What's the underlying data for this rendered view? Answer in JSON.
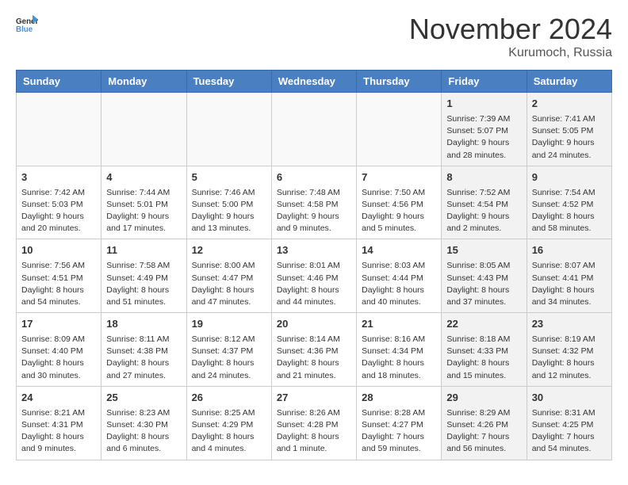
{
  "header": {
    "logo_line1": "General",
    "logo_line2": "Blue",
    "month": "November 2024",
    "location": "Kurumoch, Russia"
  },
  "weekdays": [
    "Sunday",
    "Monday",
    "Tuesday",
    "Wednesday",
    "Thursday",
    "Friday",
    "Saturday"
  ],
  "weeks": [
    [
      {
        "day": "",
        "info": ""
      },
      {
        "day": "",
        "info": ""
      },
      {
        "day": "",
        "info": ""
      },
      {
        "day": "",
        "info": ""
      },
      {
        "day": "",
        "info": ""
      },
      {
        "day": "1",
        "info": "Sunrise: 7:39 AM\nSunset: 5:07 PM\nDaylight: 9 hours\nand 28 minutes."
      },
      {
        "day": "2",
        "info": "Sunrise: 7:41 AM\nSunset: 5:05 PM\nDaylight: 9 hours\nand 24 minutes."
      }
    ],
    [
      {
        "day": "3",
        "info": "Sunrise: 7:42 AM\nSunset: 5:03 PM\nDaylight: 9 hours\nand 20 minutes."
      },
      {
        "day": "4",
        "info": "Sunrise: 7:44 AM\nSunset: 5:01 PM\nDaylight: 9 hours\nand 17 minutes."
      },
      {
        "day": "5",
        "info": "Sunrise: 7:46 AM\nSunset: 5:00 PM\nDaylight: 9 hours\nand 13 minutes."
      },
      {
        "day": "6",
        "info": "Sunrise: 7:48 AM\nSunset: 4:58 PM\nDaylight: 9 hours\nand 9 minutes."
      },
      {
        "day": "7",
        "info": "Sunrise: 7:50 AM\nSunset: 4:56 PM\nDaylight: 9 hours\nand 5 minutes."
      },
      {
        "day": "8",
        "info": "Sunrise: 7:52 AM\nSunset: 4:54 PM\nDaylight: 9 hours\nand 2 minutes."
      },
      {
        "day": "9",
        "info": "Sunrise: 7:54 AM\nSunset: 4:52 PM\nDaylight: 8 hours\nand 58 minutes."
      }
    ],
    [
      {
        "day": "10",
        "info": "Sunrise: 7:56 AM\nSunset: 4:51 PM\nDaylight: 8 hours\nand 54 minutes."
      },
      {
        "day": "11",
        "info": "Sunrise: 7:58 AM\nSunset: 4:49 PM\nDaylight: 8 hours\nand 51 minutes."
      },
      {
        "day": "12",
        "info": "Sunrise: 8:00 AM\nSunset: 4:47 PM\nDaylight: 8 hours\nand 47 minutes."
      },
      {
        "day": "13",
        "info": "Sunrise: 8:01 AM\nSunset: 4:46 PM\nDaylight: 8 hours\nand 44 minutes."
      },
      {
        "day": "14",
        "info": "Sunrise: 8:03 AM\nSunset: 4:44 PM\nDaylight: 8 hours\nand 40 minutes."
      },
      {
        "day": "15",
        "info": "Sunrise: 8:05 AM\nSunset: 4:43 PM\nDaylight: 8 hours\nand 37 minutes."
      },
      {
        "day": "16",
        "info": "Sunrise: 8:07 AM\nSunset: 4:41 PM\nDaylight: 8 hours\nand 34 minutes."
      }
    ],
    [
      {
        "day": "17",
        "info": "Sunrise: 8:09 AM\nSunset: 4:40 PM\nDaylight: 8 hours\nand 30 minutes."
      },
      {
        "day": "18",
        "info": "Sunrise: 8:11 AM\nSunset: 4:38 PM\nDaylight: 8 hours\nand 27 minutes."
      },
      {
        "day": "19",
        "info": "Sunrise: 8:12 AM\nSunset: 4:37 PM\nDaylight: 8 hours\nand 24 minutes."
      },
      {
        "day": "20",
        "info": "Sunrise: 8:14 AM\nSunset: 4:36 PM\nDaylight: 8 hours\nand 21 minutes."
      },
      {
        "day": "21",
        "info": "Sunrise: 8:16 AM\nSunset: 4:34 PM\nDaylight: 8 hours\nand 18 minutes."
      },
      {
        "day": "22",
        "info": "Sunrise: 8:18 AM\nSunset: 4:33 PM\nDaylight: 8 hours\nand 15 minutes."
      },
      {
        "day": "23",
        "info": "Sunrise: 8:19 AM\nSunset: 4:32 PM\nDaylight: 8 hours\nand 12 minutes."
      }
    ],
    [
      {
        "day": "24",
        "info": "Sunrise: 8:21 AM\nSunset: 4:31 PM\nDaylight: 8 hours\nand 9 minutes."
      },
      {
        "day": "25",
        "info": "Sunrise: 8:23 AM\nSunset: 4:30 PM\nDaylight: 8 hours\nand 6 minutes."
      },
      {
        "day": "26",
        "info": "Sunrise: 8:25 AM\nSunset: 4:29 PM\nDaylight: 8 hours\nand 4 minutes."
      },
      {
        "day": "27",
        "info": "Sunrise: 8:26 AM\nSunset: 4:28 PM\nDaylight: 8 hours\nand 1 minute."
      },
      {
        "day": "28",
        "info": "Sunrise: 8:28 AM\nSunset: 4:27 PM\nDaylight: 7 hours\nand 59 minutes."
      },
      {
        "day": "29",
        "info": "Sunrise: 8:29 AM\nSunset: 4:26 PM\nDaylight: 7 hours\nand 56 minutes."
      },
      {
        "day": "30",
        "info": "Sunrise: 8:31 AM\nSunset: 4:25 PM\nDaylight: 7 hours\nand 54 minutes."
      }
    ]
  ]
}
